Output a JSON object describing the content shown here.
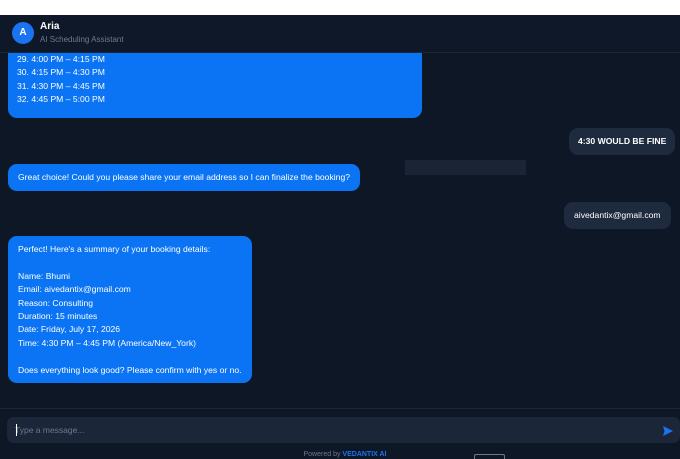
{
  "header": {
    "avatar_initial": "A",
    "name": "Aria",
    "role": "AI Scheduling Assistant"
  },
  "messages": {
    "slots": {
      "lines": [
        "29. 4:00 PM – 4:15 PM",
        "30. 4:15 PM – 4:30 PM",
        "31. 4:30 PM – 4:45 PM",
        "32. 4:45 PM – 5:00 PM"
      ]
    },
    "user_reply_1": "4:30 WOULD BE FINE",
    "bot_email_request": "Great choice! Could you please share your email address so I can finalize the booking?",
    "user_reply_2": "aivedantix@gmail.com",
    "summary": {
      "intro": "Perfect! Here's a summary of your booking details:",
      "name": "Name: Bhumi",
      "email": "Email: aivedantix@gmail.com",
      "reason": "Reason: Consulting",
      "duration": "Duration: 15 minutes",
      "date": "Date: Friday, July 17, 2026",
      "time": "Time: 4:30 PM – 4:45 PM (America/New_York)",
      "confirm": "Does everything look good? Please confirm with yes or no."
    }
  },
  "composer": {
    "placeholder": "Type a message...",
    "footer_prefix": "Powered by",
    "footer_brand": "VEDANTIX AI"
  },
  "colors": {
    "bot_bubble": "#0a74f5",
    "user_bubble": "#1e2b3e",
    "background": "#0e1726",
    "accent": "#1a73f0"
  },
  "icons": {
    "send": "send-icon"
  }
}
